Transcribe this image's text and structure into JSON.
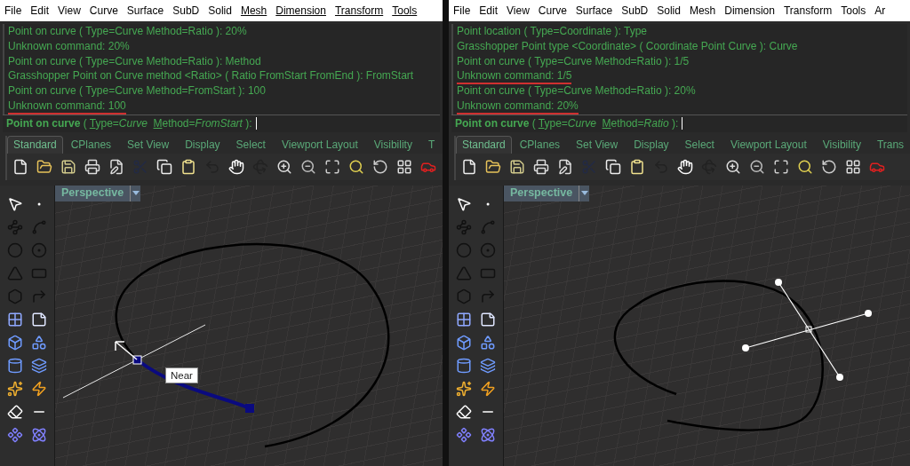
{
  "panels": [
    {
      "menu": [
        {
          "label": "File",
          "underlined": false
        },
        {
          "label": "Edit",
          "underlined": false
        },
        {
          "label": "View",
          "underlined": false
        },
        {
          "label": "Curve",
          "underlined": false
        },
        {
          "label": "Surface",
          "underlined": false
        },
        {
          "label": "SubD",
          "underlined": false
        },
        {
          "label": "Solid",
          "underlined": false
        },
        {
          "label": "Mesh",
          "underlined": true
        },
        {
          "label": "Dimension",
          "underlined": true
        },
        {
          "label": "Transform",
          "underlined": true
        },
        {
          "label": "Tools",
          "underlined": true
        }
      ],
      "history": [
        {
          "text": "Point on curve ( Type=Curve  Method=Ratio ): 20%",
          "flagged": false
        },
        {
          "text": "Unknown command: 20%",
          "flagged": false
        },
        {
          "text": "Point on curve ( Type=Curve  Method=Ratio ): Method",
          "flagged": false
        },
        {
          "text": "Grasshopper Point on Curve method <Ratio> ( Ratio  FromStart  FromEnd ): FromStart",
          "flagged": false
        },
        {
          "text": "Point on curve ( Type=Curve  Method=FromStart ): 100",
          "flagged": false
        },
        {
          "text": "Unknown command: 100",
          "flagged": true
        }
      ],
      "prompt": [
        {
          "text": "Point on curve",
          "kind": "bold"
        },
        {
          "text": " ( ",
          "kind": "plain"
        },
        {
          "text": "T",
          "kind": "underline"
        },
        {
          "text": "ype=",
          "kind": "plain"
        },
        {
          "text": "Curve  ",
          "kind": "italic"
        },
        {
          "text": "M",
          "kind": "underline"
        },
        {
          "text": "ethod=",
          "kind": "plain"
        },
        {
          "text": "FromStart",
          "kind": "italic"
        },
        {
          "text": " ):",
          "kind": "plain"
        }
      ],
      "tabs": [
        {
          "label": "Standard",
          "selected": true
        },
        {
          "label": "CPlanes",
          "selected": false
        },
        {
          "label": "Set View",
          "selected": false
        },
        {
          "label": "Display",
          "selected": false
        },
        {
          "label": "Select",
          "selected": false
        },
        {
          "label": "Viewport Layout",
          "selected": false
        },
        {
          "label": "Visibility",
          "selected": false
        },
        {
          "label": "T",
          "selected": false
        }
      ],
      "viewport": {
        "title": "Perspective",
        "tooltip": "Near",
        "objects": [
          {
            "kind": "curve"
          },
          {
            "kind": "snap-segment"
          },
          {
            "kind": "tangent-line"
          }
        ]
      }
    },
    {
      "menu": [
        {
          "label": "File",
          "underlined": false
        },
        {
          "label": "Edit",
          "underlined": false
        },
        {
          "label": "View",
          "underlined": false
        },
        {
          "label": "Curve",
          "underlined": false
        },
        {
          "label": "Surface",
          "underlined": false
        },
        {
          "label": "SubD",
          "underlined": false
        },
        {
          "label": "Solid",
          "underlined": false
        },
        {
          "label": "Mesh",
          "underlined": false
        },
        {
          "label": "Dimension",
          "underlined": false
        },
        {
          "label": "Transform",
          "underlined": false
        },
        {
          "label": "Tools",
          "underlined": false
        },
        {
          "label": "Ar",
          "underlined": false
        }
      ],
      "history": [
        {
          "text": "Point location ( Type=Coordinate ): Type",
          "flagged": false
        },
        {
          "text": "Grasshopper Point type <Coordinate> ( Coordinate  Point  Curve ): Curve",
          "flagged": false
        },
        {
          "text": "Point on curve ( Type=Curve  Method=Ratio ): 1/5",
          "flagged": false
        },
        {
          "text": "Unknown command: 1/5",
          "flagged": true
        },
        {
          "text": "Point on curve ( Type=Curve  Method=Ratio ): 20%",
          "flagged": false
        },
        {
          "text": "Unknown command: 20%",
          "flagged": true
        }
      ],
      "prompt": [
        {
          "text": "Point on curve",
          "kind": "bold"
        },
        {
          "text": " ( ",
          "kind": "plain"
        },
        {
          "text": "T",
          "kind": "underline"
        },
        {
          "text": "ype=",
          "kind": "plain"
        },
        {
          "text": "Curve  ",
          "kind": "italic"
        },
        {
          "text": "M",
          "kind": "underline"
        },
        {
          "text": "ethod=",
          "kind": "plain"
        },
        {
          "text": "Ratio",
          "kind": "italic"
        },
        {
          "text": " ):",
          "kind": "plain"
        }
      ],
      "tabs": [
        {
          "label": "Standard",
          "selected": true
        },
        {
          "label": "CPlanes",
          "selected": false
        },
        {
          "label": "Set View",
          "selected": false
        },
        {
          "label": "Display",
          "selected": false
        },
        {
          "label": "Select",
          "selected": false
        },
        {
          "label": "Viewport Layout",
          "selected": false
        },
        {
          "label": "Visibility",
          "selected": false
        },
        {
          "label": "Trans",
          "selected": false
        }
      ],
      "viewport": {
        "title": "Perspective",
        "objects": [
          {
            "kind": "curve"
          },
          {
            "kind": "gumball"
          }
        ]
      }
    }
  ]
}
